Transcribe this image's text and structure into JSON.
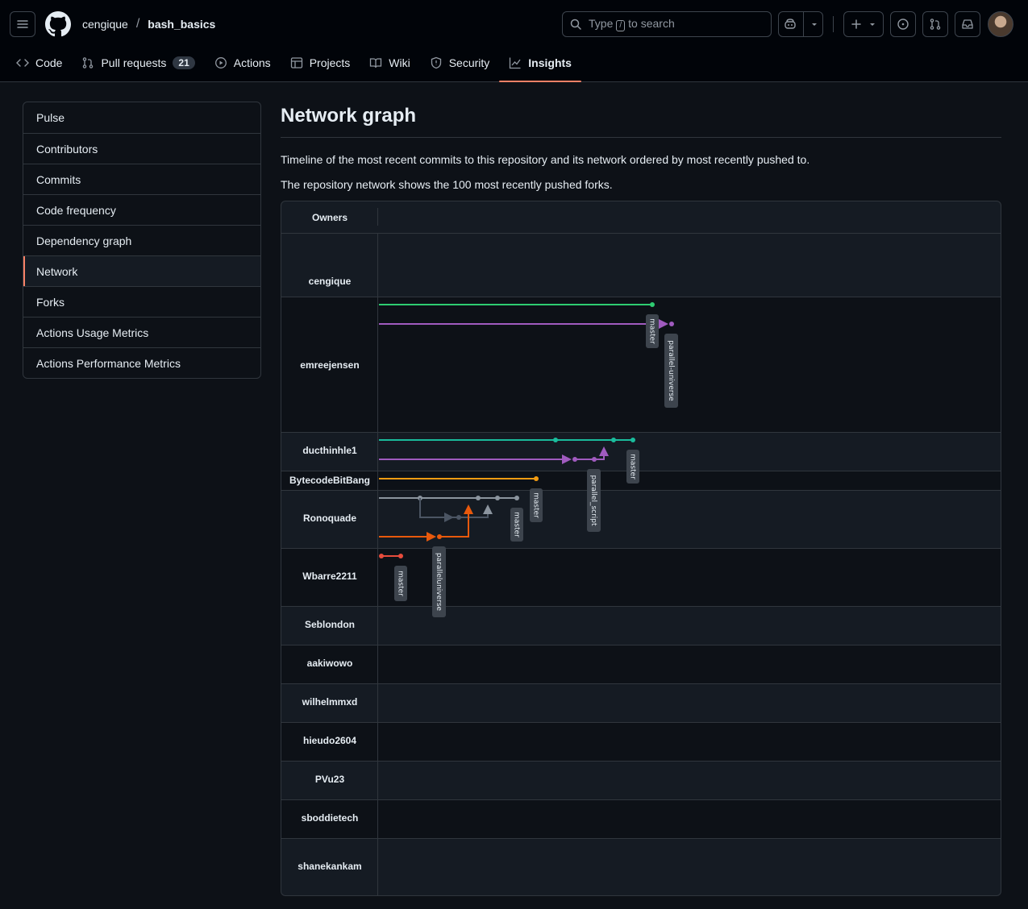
{
  "header": {
    "owner": "cengique",
    "separator": "/",
    "repo": "bash_basics",
    "search": {
      "before": "Type",
      "key": "/",
      "after": "to search"
    }
  },
  "tabs": [
    {
      "label": "Code"
    },
    {
      "label": "Pull requests",
      "count": "21"
    },
    {
      "label": "Actions"
    },
    {
      "label": "Projects"
    },
    {
      "label": "Wiki"
    },
    {
      "label": "Security"
    },
    {
      "label": "Insights",
      "active": true
    }
  ],
  "sidebar": {
    "items": [
      {
        "label": "Pulse"
      },
      {
        "label": "Contributors"
      },
      {
        "label": "Commits"
      },
      {
        "label": "Code frequency"
      },
      {
        "label": "Dependency graph"
      },
      {
        "label": "Network",
        "selected": true
      },
      {
        "label": "Forks"
      },
      {
        "label": "Actions Usage Metrics"
      },
      {
        "label": "Actions Performance Metrics"
      }
    ]
  },
  "main": {
    "title": "Network graph",
    "desc1": "Timeline of the most recent commits to this repository and its network ordered by most recently pushed to.",
    "desc2": "The repository network shows the 100 most recently pushed forks."
  },
  "graph": {
    "owners_header": "Owners",
    "owners": [
      {
        "name": "cengique"
      },
      {
        "name": "emreejensen"
      },
      {
        "name": "ducthinhle1"
      },
      {
        "name": "BytecodeBitBang"
      },
      {
        "name": "Ronoquade"
      },
      {
        "name": "Wbarre2211"
      },
      {
        "name": "Seblondon"
      },
      {
        "name": "aakiwowo"
      },
      {
        "name": "wilhelmmxd"
      },
      {
        "name": "hieudo2604"
      },
      {
        "name": "PVu23"
      },
      {
        "name": "sboddietech"
      },
      {
        "name": "shanekankam"
      }
    ],
    "branch_labels": [
      {
        "owner": "emreejensen",
        "text": "master"
      },
      {
        "owner": "emreejensen",
        "text": "parallel-universe"
      },
      {
        "owner": "ducthinhle1",
        "text": "master"
      },
      {
        "owner": "ducthinhle1",
        "text": "parallel_script"
      },
      {
        "owner": "BytecodeBitBang",
        "text": "master"
      },
      {
        "owner": "Ronoquade",
        "text": "master"
      },
      {
        "owner": "Wbarre2211",
        "text": "master"
      },
      {
        "owner": "Wbarre2211",
        "text": "paralleluniverse"
      }
    ],
    "colors": {
      "green": "#2ecc71",
      "purple": "#a05bbf",
      "teal": "#1abc9c",
      "orange": "#f39c12",
      "gray": "#8b949e",
      "darkgray": "#4b5563",
      "redorange": "#e8590c",
      "red": "#e74c3c",
      "label_bg": "#3d444d"
    }
  }
}
